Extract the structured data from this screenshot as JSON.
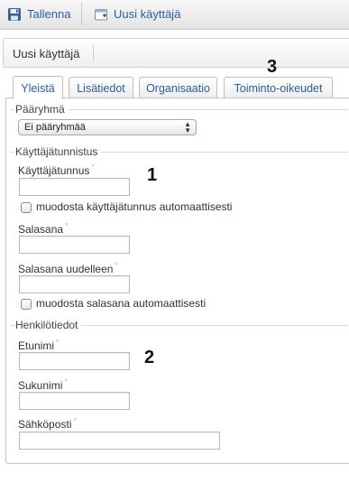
{
  "toolbar": {
    "save_label": "Tallenna",
    "new_user_label": "Uusi käyttäjä"
  },
  "title": "Uusi käyttäjä",
  "tabs": [
    "Yleistä",
    "Lisätiedot",
    "Organisaatio",
    "Toiminto-oikeudet"
  ],
  "active_tab": "Yleistä",
  "sections": {
    "main_group": {
      "legend": "Pääryhmä",
      "select_value": "Ei pääryhmää"
    },
    "credentials": {
      "legend": "Käyttäjätunnistus",
      "username_label": "Käyttäjätunnus",
      "username_value": "",
      "auto_username_label": "muodosta käyttäjätunnus automaattisesti",
      "password_label": "Salasana",
      "password_value": "",
      "password_again_label": "Salasana uudelleen",
      "password_again_value": "",
      "auto_password_label": "muodosta salasana automaattisesti"
    },
    "personal": {
      "legend": "Henkilötiedot",
      "firstname_label": "Etunimi",
      "firstname_value": "",
      "lastname_label": "Sukunimi",
      "lastname_value": "",
      "email_label": "Sähköposti",
      "email_value": ""
    }
  },
  "required_marker": "*",
  "annotations": [
    "1",
    "2",
    "3"
  ]
}
